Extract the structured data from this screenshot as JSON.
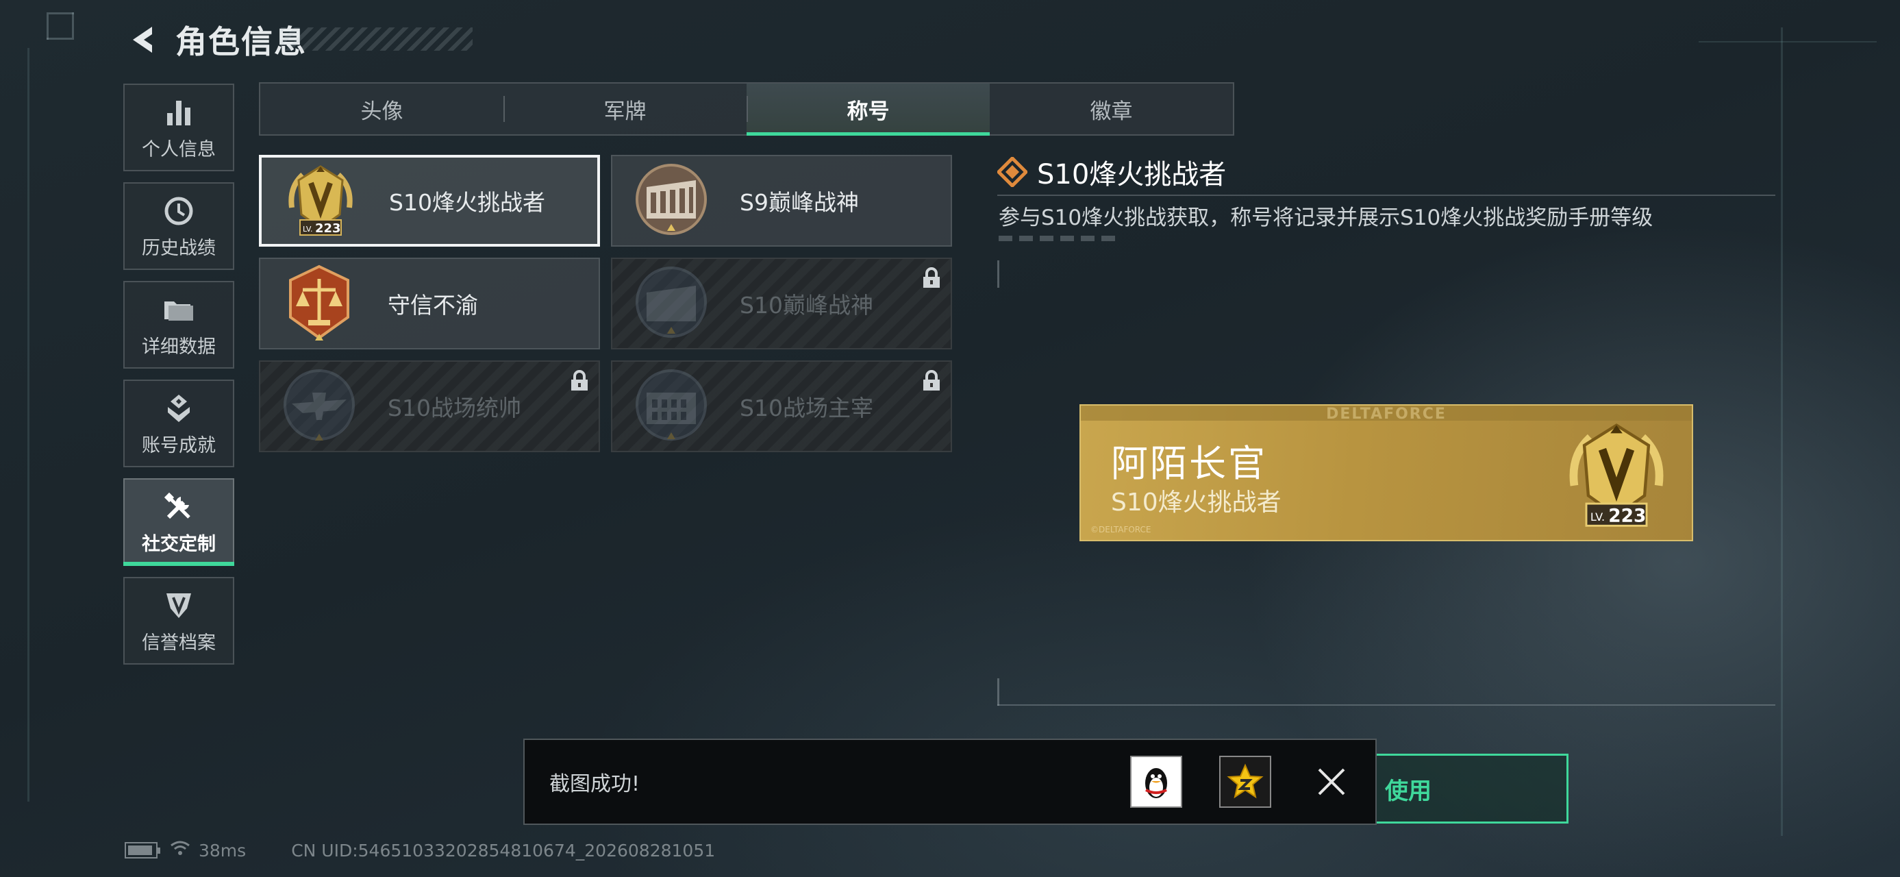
{
  "header": {
    "title": "角色信息",
    "back_icon": "back-arrow-icon"
  },
  "sidebar": {
    "items": [
      {
        "label": "个人信息",
        "icon": "bar-chart-icon",
        "active": false
      },
      {
        "label": "历史战绩",
        "icon": "history-clock-icon",
        "active": false
      },
      {
        "label": "详细数据",
        "icon": "folder-icon",
        "active": false
      },
      {
        "label": "账号成就",
        "icon": "achievement-icon",
        "active": false
      },
      {
        "label": "社交定制",
        "icon": "tools-icon",
        "active": true
      },
      {
        "label": "信誉档案",
        "icon": "shield-emblem-icon",
        "active": false
      }
    ]
  },
  "tabs": [
    {
      "label": "头像",
      "active": false
    },
    {
      "label": "军牌",
      "active": false
    },
    {
      "label": "称号",
      "active": true
    },
    {
      "label": "徽章",
      "active": false
    }
  ],
  "titles": [
    {
      "name": "S10烽火挑战者",
      "level": "223",
      "level_prefix": "LV.",
      "state": "selected"
    },
    {
      "name": "S9巅峰战神",
      "state": "available"
    },
    {
      "name": "守信不渝",
      "state": "available"
    },
    {
      "name": "S10巅峰战神",
      "state": "locked"
    },
    {
      "name": "S10战场统帅",
      "state": "locked"
    },
    {
      "name": "S10战场主宰",
      "state": "locked"
    }
  ],
  "detail": {
    "title": "S10烽火挑战者",
    "description": "参与S10烽火挑战获取，称号将记录并展示S10烽火挑战奖励手册等级"
  },
  "nameplate": {
    "brand": "DELTAFORCE",
    "player_name": "阿陌长官",
    "title": "S10烽火挑战者",
    "level_prefix": "LV.",
    "level": "223",
    "fine_print": "©DELTAFORCE"
  },
  "use_button": {
    "label": "使用"
  },
  "toast": {
    "message": "截图成功!",
    "share_qq_icon": "qq-penguin-icon",
    "share_qzone_icon": "qzone-star-icon",
    "close_icon": "close-icon"
  },
  "status_bar": {
    "ping": "38ms",
    "uid": "CN UID:5465103320285481067­4_202608281051",
    "battery_level": 0.8
  },
  "colors": {
    "accent": "#3fd89b",
    "gold": "#c9a64e",
    "panel": "#3a4247"
  }
}
